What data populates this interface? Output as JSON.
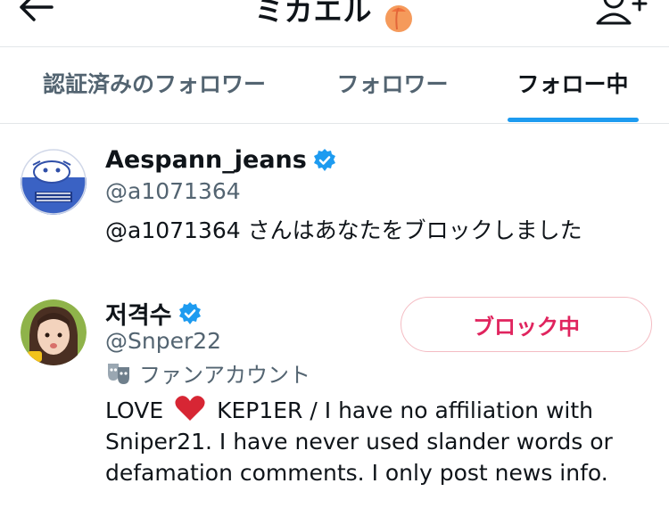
{
  "header": {
    "title": "ミカエル"
  },
  "tabs": [
    {
      "label": "認証済みのフォロワー"
    },
    {
      "label": "フォロワー"
    },
    {
      "label": "フォロー中"
    }
  ],
  "users": [
    {
      "display_name": "Aespann_jeans",
      "handle": "@a1071364",
      "verified": true,
      "message": "@a1071364 さんはあなたをブロックしました"
    },
    {
      "display_name": "저격수",
      "handle": "@Snper22",
      "verified": true,
      "fan_label": "ファンアカウント",
      "button_label": "ブロック中",
      "bio_prefix": "LOVE",
      "bio_line1_rest": "KEP1ER / I have no affiliation with",
      "bio_line2": "Sniper21. I have never used slander words or",
      "bio_line3": "defamation comments. I only post news info."
    }
  ],
  "colors": {
    "accent": "#1d9bf0",
    "danger": "#e0245e",
    "muted": "#536471"
  }
}
